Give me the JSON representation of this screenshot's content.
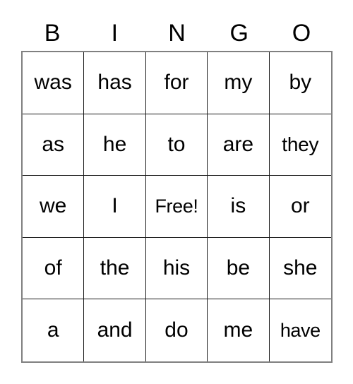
{
  "card": {
    "title": "BINGO",
    "headers": [
      "B",
      "I",
      "N",
      "G",
      "O"
    ],
    "free_space": {
      "row": 3,
      "column": 3,
      "label": "Free!"
    },
    "grid_size": "5x5",
    "colors": {
      "text": "#000000",
      "outer_border": "#808080",
      "inner_border": "#1a1a1a",
      "background": "#ffffff"
    },
    "rows": [
      {
        "cells": [
          "was",
          "has",
          "for",
          "my",
          "by"
        ]
      },
      {
        "cells": [
          "as",
          "he",
          "to",
          "are",
          "they"
        ]
      },
      {
        "cells": [
          "we",
          "I",
          "Free!",
          "is",
          "or"
        ]
      },
      {
        "cells": [
          "of",
          "the",
          "his",
          "be",
          "she"
        ]
      },
      {
        "cells": [
          "a",
          "and",
          "do",
          "me",
          "have"
        ]
      }
    ]
  }
}
